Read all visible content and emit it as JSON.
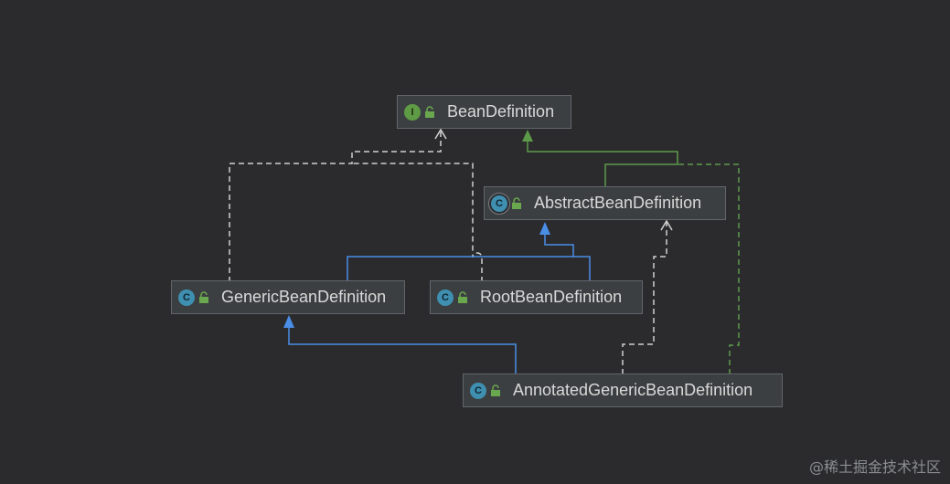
{
  "nodes": {
    "bean_definition": {
      "label": "BeanDefinition",
      "kind": "interface",
      "badge": "I"
    },
    "abstract_bean_definition": {
      "label": "AbstractBeanDefinition",
      "kind": "abstract-class",
      "badge": "C"
    },
    "generic_bean_definition": {
      "label": "GenericBeanDefinition",
      "kind": "class",
      "badge": "C"
    },
    "root_bean_definition": {
      "label": "RootBeanDefinition",
      "kind": "class",
      "badge": "C"
    },
    "annotated_generic_bean_definition": {
      "label": "AnnotatedGenericBeanDefinition",
      "kind": "class",
      "badge": "C"
    }
  },
  "edges": [
    {
      "from": "abstract_bean_definition",
      "to": "bean_definition",
      "kind": "implements"
    },
    {
      "from": "generic_bean_definition",
      "to": "bean_definition",
      "kind": "implements"
    },
    {
      "from": "root_bean_definition",
      "to": "bean_definition",
      "kind": "implements"
    },
    {
      "from": "annotated_generic_bean_definition",
      "to": "bean_definition",
      "kind": "implements"
    },
    {
      "from": "generic_bean_definition",
      "to": "abstract_bean_definition",
      "kind": "extends"
    },
    {
      "from": "root_bean_definition",
      "to": "abstract_bean_definition",
      "kind": "extends"
    },
    {
      "from": "annotated_generic_bean_definition",
      "to": "generic_bean_definition",
      "kind": "extends"
    },
    {
      "from": "annotated_generic_bean_definition",
      "to": "abstract_bean_definition",
      "kind": "implements"
    }
  ],
  "colors": {
    "background": "#2b2b2e",
    "extends_edge": "#4a8ee6",
    "implements_edge": "#d0d0d0",
    "interface_edge": "#5c9a4a",
    "node_fill": "#3c3f41",
    "node_border": "#62666a",
    "text": "#d9d9d9"
  },
  "watermark": "@稀土掘金技术社区"
}
